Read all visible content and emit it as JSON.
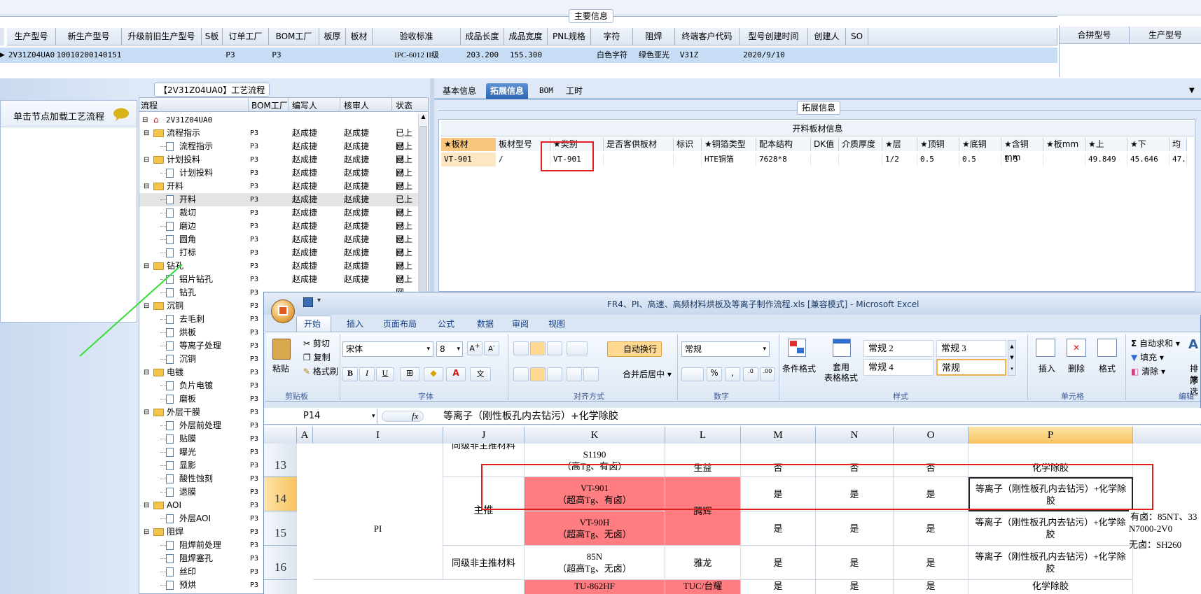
{
  "main_info_title": "主要信息",
  "merge_cols": [
    "合拼型号",
    "生产型号"
  ],
  "header": {
    "cols": [
      "生产型号",
      "新生产型号",
      "升级前旧生产型号",
      "S板",
      "订单工厂",
      "BOM工厂",
      "板厚",
      "板材",
      "验收标准",
      "成品长度",
      "成品宽度",
      "PNL规格",
      "字符",
      "阻焊",
      "终端客户代码",
      "型号创建时间",
      "创建人",
      "SO"
    ],
    "values": [
      "2V31Z04UA0",
      "10010200140151",
      "",
      "",
      "P3",
      "P3",
      "",
      "",
      "IPC-6012 II级",
      "203.200",
      "155.300",
      "",
      "白色字符",
      "绿色亚光",
      "V31Z",
      "2020/9/10",
      "",
      ""
    ]
  },
  "process": {
    "title": "【2V31Z04UA0】工艺流程",
    "load_hint": "单击节点加载工艺流程",
    "columns": [
      "流程",
      "BOM工厂",
      "编写人",
      "核审人",
      "状态"
    ],
    "root": "2V31Z04UA0",
    "rows": [
      {
        "name": "流程指示",
        "level": 1,
        "folder": true,
        "factory": "P3",
        "writer": "赵成捷",
        "reviewer": "赵成捷",
        "status": "已上网"
      },
      {
        "name": "流程指示",
        "level": 2,
        "folder": false,
        "factory": "P3",
        "writer": "赵成捷",
        "reviewer": "赵成捷",
        "status": "已上网"
      },
      {
        "name": "计划投料",
        "level": 1,
        "folder": true,
        "factory": "P3",
        "writer": "赵成捷",
        "reviewer": "赵成捷",
        "status": "已上网"
      },
      {
        "name": "计划投料",
        "level": 2,
        "folder": false,
        "factory": "P3",
        "writer": "赵成捷",
        "reviewer": "赵成捷",
        "status": "已上网"
      },
      {
        "name": "开料",
        "level": 1,
        "folder": true,
        "factory": "P3",
        "writer": "赵成捷",
        "reviewer": "赵成捷",
        "status": "已上网"
      },
      {
        "name": "开料",
        "level": 2,
        "folder": false,
        "factory": "P3",
        "writer": "赵成捷",
        "reviewer": "赵成捷",
        "status": "已上网",
        "selected": true
      },
      {
        "name": "裁切",
        "level": 2,
        "folder": false,
        "factory": "P3",
        "writer": "赵成捷",
        "reviewer": "赵成捷",
        "status": "已上网"
      },
      {
        "name": "磨边",
        "level": 2,
        "folder": false,
        "factory": "P3",
        "writer": "赵成捷",
        "reviewer": "赵成捷",
        "status": "已上网"
      },
      {
        "name": "圆角",
        "level": 2,
        "folder": false,
        "factory": "P3",
        "writer": "赵成捷",
        "reviewer": "赵成捷",
        "status": "已上网"
      },
      {
        "name": "打标",
        "level": 2,
        "folder": false,
        "factory": "P3",
        "writer": "赵成捷",
        "reviewer": "赵成捷",
        "status": "已上网"
      },
      {
        "name": "钻孔",
        "level": 1,
        "folder": true,
        "factory": "P3",
        "writer": "赵成捷",
        "reviewer": "赵成捷",
        "status": "已上网"
      },
      {
        "name": "铝片钻孔",
        "level": 2,
        "folder": false,
        "factory": "P3",
        "writer": "赵成捷",
        "reviewer": "赵成捷",
        "status": "已上网"
      },
      {
        "name": "钻孔",
        "level": 2,
        "folder": false,
        "factory": "P3",
        "writer": "",
        "reviewer": "",
        "status": ""
      },
      {
        "name": "沉铜",
        "level": 1,
        "folder": true,
        "factory": "P3",
        "writer": "",
        "reviewer": "",
        "status": ""
      },
      {
        "name": "去毛刺",
        "level": 2,
        "folder": false,
        "factory": "P3",
        "writer": "",
        "reviewer": "",
        "status": ""
      },
      {
        "name": "烘板",
        "level": 2,
        "folder": false,
        "factory": "P3",
        "writer": "",
        "reviewer": "",
        "status": ""
      },
      {
        "name": "等离子处理",
        "level": 2,
        "folder": false,
        "factory": "P3",
        "writer": "",
        "reviewer": "",
        "status": ""
      },
      {
        "name": "沉铜",
        "level": 2,
        "folder": false,
        "factory": "P3",
        "writer": "",
        "reviewer": "",
        "status": ""
      },
      {
        "name": "电镀",
        "level": 1,
        "folder": true,
        "factory": "P3",
        "writer": "",
        "reviewer": "",
        "status": ""
      },
      {
        "name": "负片电镀",
        "level": 2,
        "folder": false,
        "factory": "P3",
        "writer": "",
        "reviewer": "",
        "status": ""
      },
      {
        "name": "磨板",
        "level": 2,
        "folder": false,
        "factory": "P3",
        "writer": "",
        "reviewer": "",
        "status": ""
      },
      {
        "name": "外层干膜",
        "level": 1,
        "folder": true,
        "factory": "P3",
        "writer": "",
        "reviewer": "",
        "status": ""
      },
      {
        "name": "外层前处理",
        "level": 2,
        "folder": false,
        "factory": "P3",
        "writer": "",
        "reviewer": "",
        "status": ""
      },
      {
        "name": "贴膜",
        "level": 2,
        "folder": false,
        "factory": "P3",
        "writer": "",
        "reviewer": "",
        "status": ""
      },
      {
        "name": "曝光",
        "level": 2,
        "folder": false,
        "factory": "P3",
        "writer": "",
        "reviewer": "",
        "status": ""
      },
      {
        "name": "显影",
        "level": 2,
        "folder": false,
        "factory": "P3",
        "writer": "",
        "reviewer": "",
        "status": ""
      },
      {
        "name": "酸性蚀刻",
        "level": 2,
        "folder": false,
        "factory": "P3",
        "writer": "",
        "reviewer": "",
        "status": ""
      },
      {
        "name": "退膜",
        "level": 2,
        "folder": false,
        "factory": "P3",
        "writer": "",
        "reviewer": "",
        "status": ""
      },
      {
        "name": "AOI",
        "level": 1,
        "folder": true,
        "factory": "P3",
        "writer": "",
        "reviewer": "",
        "status": ""
      },
      {
        "name": "外层AOI",
        "level": 2,
        "folder": false,
        "factory": "P3",
        "writer": "",
        "reviewer": "",
        "status": ""
      },
      {
        "name": "阻焊",
        "level": 1,
        "folder": true,
        "factory": "P3",
        "writer": "",
        "reviewer": "",
        "status": ""
      },
      {
        "name": "阻焊前处理",
        "level": 2,
        "folder": false,
        "factory": "P3",
        "writer": "",
        "reviewer": "",
        "status": ""
      },
      {
        "name": "阻焊塞孔",
        "level": 2,
        "folder": false,
        "factory": "P3",
        "writer": "",
        "reviewer": "",
        "status": ""
      },
      {
        "name": "丝印",
        "level": 2,
        "folder": false,
        "factory": "P3",
        "writer": "",
        "reviewer": "",
        "status": ""
      },
      {
        "name": "预烘",
        "level": 2,
        "folder": false,
        "factory": "P3",
        "writer": "",
        "reviewer": "",
        "status": ""
      }
    ]
  },
  "tabs": [
    "基本信息",
    "拓展信息",
    "BOM",
    "工时"
  ],
  "active_tab": 1,
  "ext": {
    "group_title": "拓展信息",
    "table_title": "开料板材信息",
    "cols": [
      "★板材",
      "板材型号",
      "★类别",
      "是否客供板材",
      "标识",
      "★铜箔类型",
      "配本结构",
      "DK值",
      "介质厚度",
      "★层",
      "★顶铜",
      "★底铜",
      "★含铜mm",
      "★板mm",
      "★上",
      "★下",
      "均"
    ],
    "values": [
      "VT-901",
      "/",
      "VT-901",
      "",
      "",
      "HTE铜箔",
      "7628*8",
      "",
      "",
      "1/2",
      "0.5",
      "0.5",
      "1.5",
      "",
      "49.849",
      "45.646",
      "47."
    ]
  },
  "excel": {
    "title": "FR4、PI、高速、高频材料烘板及等离子制作流程.xls  [兼容模式] - Microsoft Excel",
    "ribbon_tabs": [
      "开始",
      "插入",
      "页面布局",
      "公式",
      "数据",
      "审阅",
      "视图"
    ],
    "clipboard": {
      "paste": "粘贴",
      "cut": "剪切",
      "copy": "复制",
      "format_painter": "格式刷",
      "label": "剪贴板"
    },
    "font": {
      "name": "宋体",
      "size": "8",
      "label": "字体"
    },
    "alignment": {
      "wrap": "自动换行",
      "merge": "合并后居中",
      "label": "对齐方式"
    },
    "number": {
      "format": "常规",
      "label": "数字"
    },
    "styles": {
      "conditional": "条件格式",
      "table": "套用\n表格格式",
      "cells": [
        "常规 2",
        "常规 3",
        "常规 4",
        "常规"
      ],
      "label": "样式"
    },
    "cells_group": {
      "insert": "插入",
      "delete": "删除",
      "format": "格式",
      "label": "单元格"
    },
    "editing": {
      "autosum": "自动求和",
      "fill": "填充",
      "clear": "清除",
      "sort": "排序",
      "filter": "筛选",
      "label": "编辑"
    },
    "name_box": "P14",
    "formula": "等离子（刚性板孔内去钻污）+化学除胶",
    "columns": [
      "A",
      "I",
      "J",
      "K",
      "L",
      "M",
      "N",
      "O",
      "P"
    ],
    "rows": [
      "13",
      "14",
      "15",
      "16"
    ],
    "cells": {
      "r12_j": "同级非主推材料",
      "r13_k": "S1190\n（高Tg、有卤）",
      "r13_l": "生益",
      "r13_m": "否",
      "r13_n": "否",
      "r13_o": "否",
      "r13_p": "化学除胶",
      "r14_k": "VT-901\n（超高Tg、有卤）",
      "r14_m": "是",
      "r14_n": "是",
      "r14_o": "是",
      "r14_p": "等离子（刚性板孔内去钻污）+化学除胶",
      "r14_i": "PI",
      "r14_j": "主推",
      "r14_l": "腾辉",
      "r15_k": "VT-90H\n（超高Tg、无卤）",
      "r15_m": "是",
      "r15_n": "是",
      "r15_o": "是",
      "r15_p": "等离子（刚性板孔内去钻污）+化学除胶",
      "r16_j": "同级非主推材料",
      "r16_k": "85N\n（超高Tg、无卤）",
      "r16_l": "雅龙",
      "r16_m": "是",
      "r16_n": "是",
      "r16_o": "是",
      "r16_p": "等离子（刚性板孔内去钻污）+化学除胶",
      "r17_k": "TU-862HF",
      "r17_l": "TUC/台耀",
      "r17_m": "是",
      "r17_n": "是",
      "r17_o": "是",
      "r17_p": "化学除胶",
      "side_note_1": "有卤：85NT、33",
      "side_note_2": "N7000-2V0",
      "side_note_3": "无卤：SH260"
    }
  },
  "colors": {
    "highlight_red": "#ff7c80",
    "annotation_box": "#e02020",
    "selection_blue": "#c7dcf5",
    "annotation_line": "#33dd33"
  }
}
